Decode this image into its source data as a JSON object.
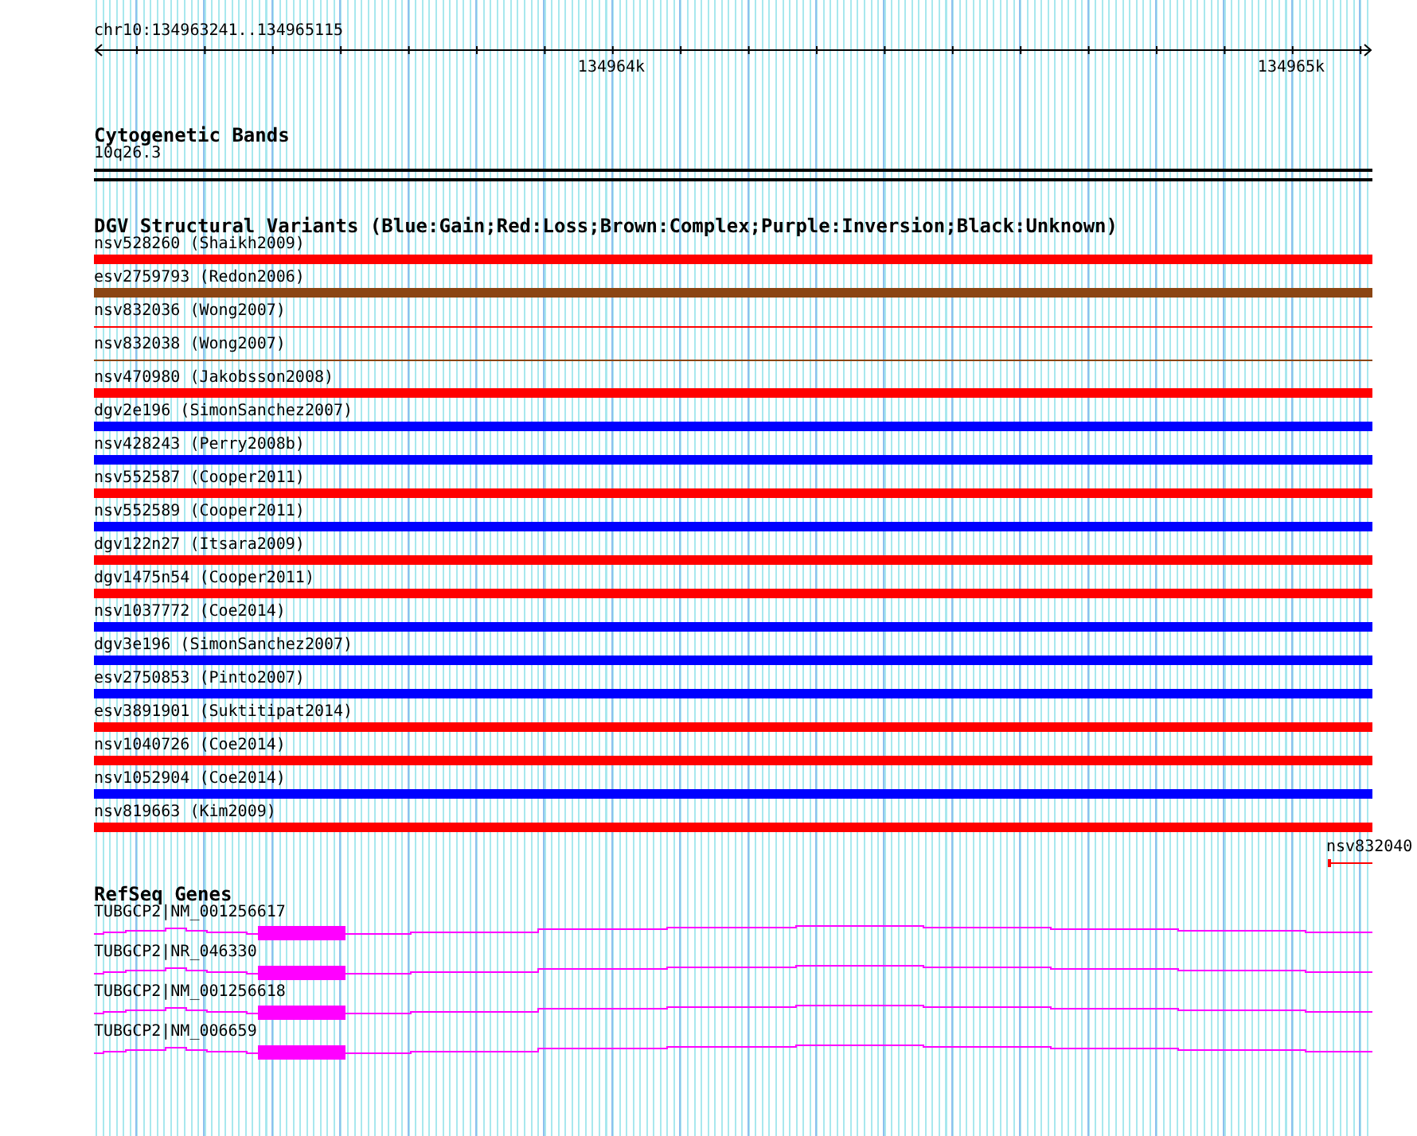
{
  "ruler": {
    "location": "chr10:134963241..134965115",
    "ticks": [
      "134964k",
      "134965k"
    ]
  },
  "cytoband_track": {
    "title": "Cytogenetic Bands",
    "band": "10q26.3"
  },
  "dgv_track": {
    "title": "DGV Structural Variants (Blue:Gain;Red:Loss;Brown:Complex;Purple:Inversion;Black:Unknown)",
    "variants": [
      {
        "label": "nsv528260 (Shaikh2009)",
        "kind": "bar",
        "color": "#ff0000"
      },
      {
        "label": "esv2759793 (Redon2006)",
        "kind": "bar",
        "color": "#8b4513"
      },
      {
        "label": "nsv832036 (Wong2007)",
        "kind": "line",
        "color": "#ff0000"
      },
      {
        "label": "nsv832038 (Wong2007)",
        "kind": "line",
        "color": "#8b4513"
      },
      {
        "label": "nsv470980 (Jakobsson2008)",
        "kind": "bar",
        "color": "#ff0000"
      },
      {
        "label": "dgv2e196 (SimonSanchez2007)",
        "kind": "bar",
        "color": "#0000ff"
      },
      {
        "label": "nsv428243 (Perry2008b)",
        "kind": "bar",
        "color": "#0000ff"
      },
      {
        "label": "nsv552587 (Cooper2011)",
        "kind": "bar",
        "color": "#ff0000"
      },
      {
        "label": "nsv552589 (Cooper2011)",
        "kind": "bar",
        "color": "#0000ff"
      },
      {
        "label": "dgv122n27 (Itsara2009)",
        "kind": "bar",
        "color": "#ff0000"
      },
      {
        "label": "dgv1475n54 (Cooper2011)",
        "kind": "bar",
        "color": "#ff0000"
      },
      {
        "label": "nsv1037772 (Coe2014)",
        "kind": "bar",
        "color": "#0000ff"
      },
      {
        "label": "dgv3e196 (SimonSanchez2007)",
        "kind": "bar",
        "color": "#0000ff"
      },
      {
        "label": "esv2750853 (Pinto2007)",
        "kind": "bar",
        "color": "#0000ff"
      },
      {
        "label": "esv3891901 (Suktitipat2014)",
        "kind": "bar",
        "color": "#ff0000"
      },
      {
        "label": "nsv1040726 (Coe2014)",
        "kind": "bar",
        "color": "#ff0000"
      },
      {
        "label": "nsv1052904 (Coe2014)",
        "kind": "bar",
        "color": "#0000ff"
      },
      {
        "label": "nsv819663 (Kim2009)",
        "kind": "bar",
        "color": "#ff0000"
      }
    ],
    "edge_variant": {
      "label": "nsv832040",
      "color": "#ff0000"
    }
  },
  "refseq_track": {
    "title": "RefSeq Genes",
    "genes": [
      {
        "label": "TUBGCP2|NM_001256617"
      },
      {
        "label": "TUBGCP2|NR_046330"
      },
      {
        "label": "TUBGCP2|NM_001256618"
      },
      {
        "label": "TUBGCP2|NM_006659"
      }
    ]
  }
}
